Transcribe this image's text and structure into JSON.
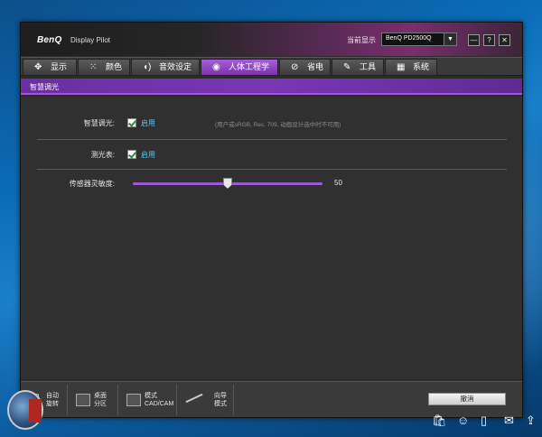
{
  "app": {
    "logo": "BenQ",
    "title": "Display Pilot",
    "current_display_label": "当前显示",
    "monitor": "BenQ PD2500Q",
    "win_buttons": [
      "—",
      "?",
      "✕"
    ]
  },
  "tabs": [
    {
      "label": "显示",
      "icon": "✥"
    },
    {
      "label": "颜色",
      "icon": "⁙"
    },
    {
      "label": "音效设定",
      "icon": "◖)"
    },
    {
      "label": "人体工程学",
      "icon": "◉",
      "active": true
    },
    {
      "label": "省电",
      "icon": "⊘"
    },
    {
      "label": "工具",
      "icon": "✎"
    },
    {
      "label": "系统",
      "icon": "▦"
    }
  ],
  "section_title": "智慧调光",
  "settings": {
    "smart_dimming": {
      "label": "智慧调光:",
      "check_label": "启用",
      "checked": true,
      "hint": "(用户或sRGB, Rec. 709, 动画设计选中时不可用)"
    },
    "light_meter": {
      "label": "测光表:",
      "check_label": "启用",
      "checked": true
    },
    "sensor": {
      "label": "传感器灵敏度:",
      "value": "50"
    }
  },
  "bottom": [
    {
      "line1": "自动",
      "line2": "旋转"
    },
    {
      "line1": "桌面",
      "line2": "分区"
    },
    {
      "line1": "模式",
      "line2": "CAD/CAM"
    },
    {
      "line1": "向导",
      "line2": "模式"
    }
  ],
  "cancel_label": "撤消"
}
